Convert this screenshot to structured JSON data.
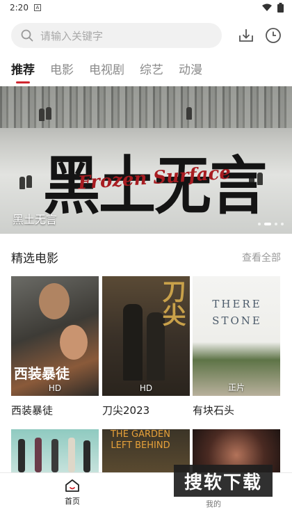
{
  "status_bar": {
    "time": "2:20",
    "notification_glyph": "A"
  },
  "search": {
    "placeholder": "请输入关键字"
  },
  "tabs": [
    {
      "label": "推荐",
      "active": true
    },
    {
      "label": "电影",
      "active": false
    },
    {
      "label": "电视剧",
      "active": false
    },
    {
      "label": "综艺",
      "active": false
    },
    {
      "label": "动漫",
      "active": false
    }
  ],
  "banner": {
    "caption": "黑土无言",
    "art_title": "黑土无言",
    "art_subtitle": "Frozen Surface",
    "page_count": 4,
    "active_page": 1
  },
  "section": {
    "title": "精选电影",
    "see_all": "查看全部"
  },
  "movies": [
    {
      "title": "西装暴徒",
      "badge": "HD",
      "poster_text": "西装暴徒"
    },
    {
      "title": "刀尖2023",
      "badge": "HD",
      "poster_text": "刀尖"
    },
    {
      "title": "有块石头",
      "badge": "正片",
      "poster_text": "THERE STONE"
    }
  ],
  "row2_posters": [
    {
      "poster_text": ""
    },
    {
      "poster_text": "THE GARDEN LEFT BEHIND"
    },
    {
      "poster_text": ""
    }
  ],
  "bottom_nav": {
    "home_label": "首页",
    "mine_label": "我的"
  },
  "watermark": {
    "text": "搜软下载"
  },
  "colors": {
    "accent": "#d0262f",
    "search_bg": "#f1f1f1",
    "muted": "#8a8a8a"
  }
}
